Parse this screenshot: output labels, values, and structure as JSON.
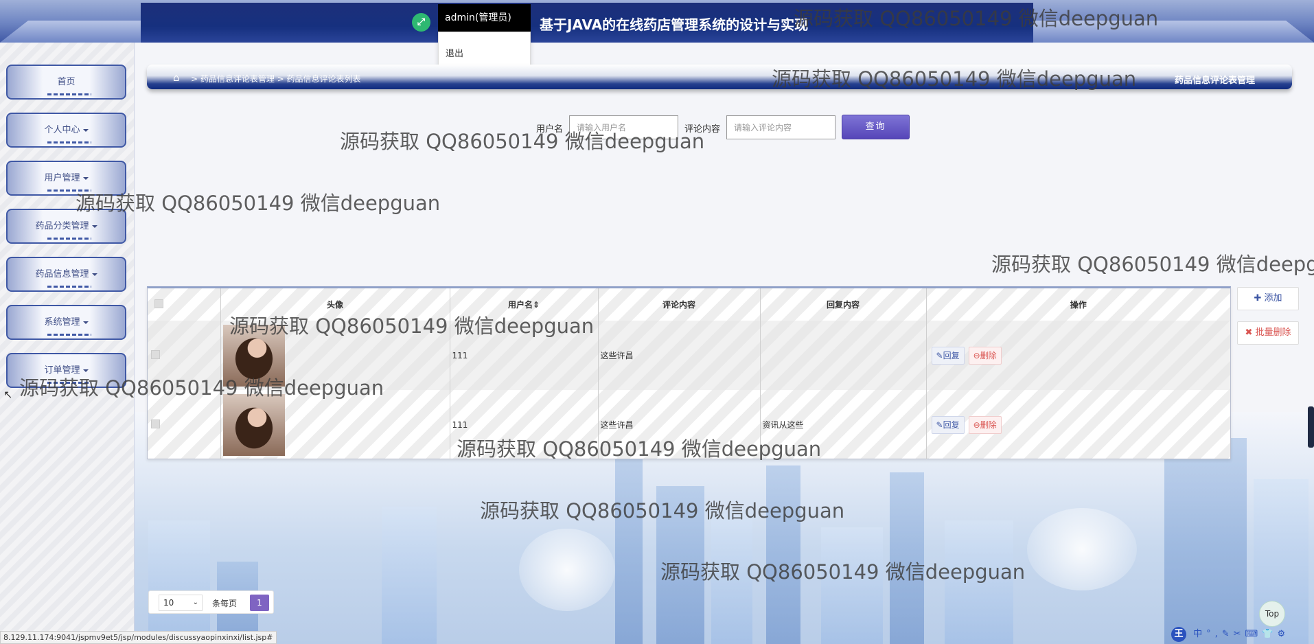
{
  "header": {
    "site_title": "基于JAVA的在线药店管理系统的设计与实现",
    "user_label": "admin(管理员)",
    "dropdown_logout": "退出",
    "fullscreen_icon": "expand-icon"
  },
  "sidebar": {
    "items": [
      {
        "label": "首页",
        "has_caret": false
      },
      {
        "label": "个人中心",
        "has_caret": true
      },
      {
        "label": "用户管理",
        "has_caret": true
      },
      {
        "label": "药品分类管理",
        "has_caret": true
      },
      {
        "label": "药品信息管理",
        "has_caret": true
      },
      {
        "label": "系统管理",
        "has_caret": true
      },
      {
        "label": "订单管理",
        "has_caret": true
      }
    ]
  },
  "breadcrumb": {
    "home_icon": "home-icon",
    "path": "> 药品信息评论表管理 > 药品信息评论表列表",
    "right_title": "药品信息评论表管理"
  },
  "search": {
    "username_label": "用户名",
    "username_placeholder": "请输入用户名",
    "content_label": "评论内容",
    "content_placeholder": "请输入评论内容",
    "query_button": "查询"
  },
  "actions": {
    "add": "添加",
    "batch_delete": "批量删除"
  },
  "table": {
    "columns": [
      "",
      "头像",
      "用户名",
      "评论内容",
      "回复内容",
      "操作"
    ],
    "sortable_column": "用户名",
    "rows": [
      {
        "username": "111",
        "comment": "这些许昌",
        "reply": "",
        "reply_btn": "回复",
        "delete_btn": "删除"
      },
      {
        "username": "111",
        "comment": "这些许昌",
        "reply": "资讯从这些",
        "reply_btn": "回复",
        "delete_btn": "删除"
      }
    ]
  },
  "pagination": {
    "page_size": "10",
    "per_page_label": "条每页",
    "current_page": "1"
  },
  "misc": {
    "top_button": "Top",
    "status_url": "8.129.11.174:9041/jspmv9et5/jsp/modules/discussyaopinxinxi/list.jsp#",
    "ime_text": "中°,✎✂⌨👕⚙",
    "ime_logo": "王"
  },
  "watermarks": [
    "源码获取 QQ86050149 微信deepguan",
    "源码获取 QQ86050149 微信deepguan",
    "源码获取 QQ86050149 微信deepguan",
    "源码获取 QQ86050149 微信deepguan",
    "源码获取 QQ86050149 微信deepg",
    "源码获取 QQ86050149 微信deepguan",
    "源码获取 QQ86050149 微信deepguan",
    "源码获取 QQ86050149 微信deepguan",
    "源码获取 QQ86050149 微信deepguan",
    "源码获取 QQ86050149 微信deepguan"
  ]
}
